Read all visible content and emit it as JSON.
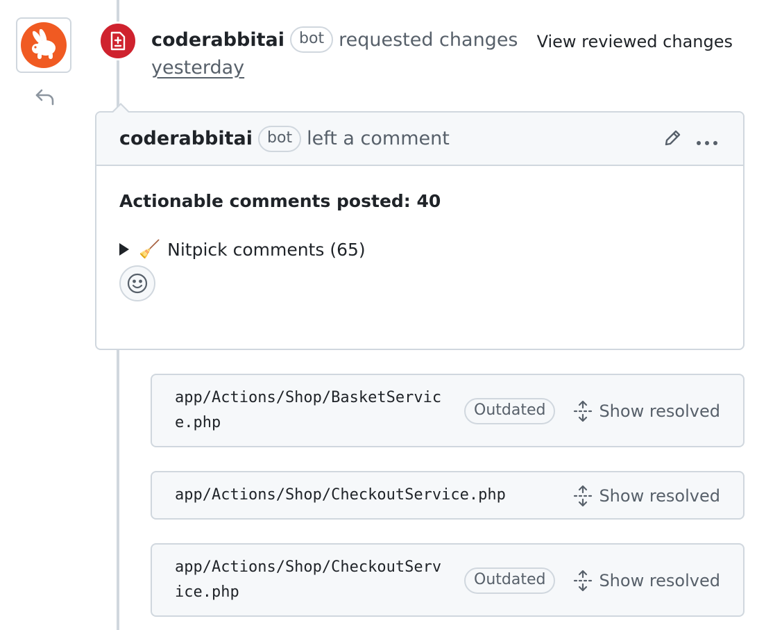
{
  "review": {
    "author": "coderabbitai",
    "bot_label": "bot",
    "action": "requested changes",
    "time": "yesterday",
    "view_link": "View reviewed changes"
  },
  "comment": {
    "author": "coderabbitai",
    "bot_label": "bot",
    "action": "left a comment",
    "actionable": "Actionable comments posted: 40",
    "nitpick_emoji": "🧹",
    "nitpick_label": "Nitpick comments (65)"
  },
  "files": [
    {
      "path": "app/Actions/Shop/BasketService.php",
      "badge": "Outdated",
      "show": "Show resolved"
    },
    {
      "path": "app/Actions/Shop/CheckoutService.php",
      "badge": "",
      "show": "Show resolved"
    },
    {
      "path": "app/Actions/Shop/CheckoutService.php",
      "badge": "Outdated",
      "show": "Show resolved"
    }
  ],
  "colors": {
    "changes_requested": "#cf222e",
    "avatar_orange": "#f05a22",
    "border": "#d0d7de",
    "muted_text": "#57606a"
  },
  "icons": [
    "file-diff-icon",
    "reply-icon",
    "pencil-icon",
    "kebab-icon",
    "smiley-icon",
    "unfold-icon"
  ]
}
